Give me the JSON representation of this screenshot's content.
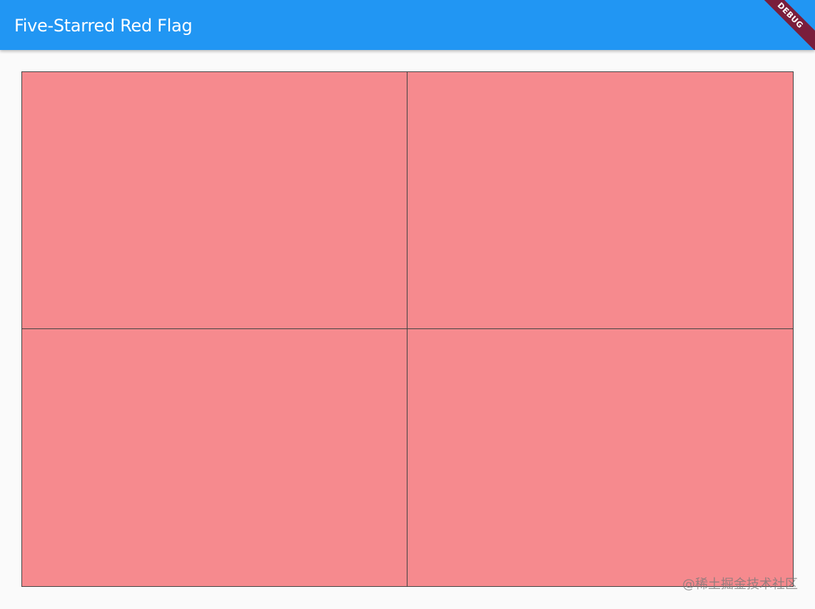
{
  "app_bar": {
    "title": "Five-Starred Red Flag",
    "background_color": "#2196f3"
  },
  "debug_banner": {
    "label": "DEBUG",
    "color": "#7a1e3c"
  },
  "flag": {
    "fill_color": "#f68a8e",
    "grid_line_color": "#444444",
    "quadrants": [
      "top-left",
      "top-right",
      "bottom-left",
      "bottom-right"
    ]
  },
  "watermark": {
    "text": "@稀土掘金技术社区"
  }
}
